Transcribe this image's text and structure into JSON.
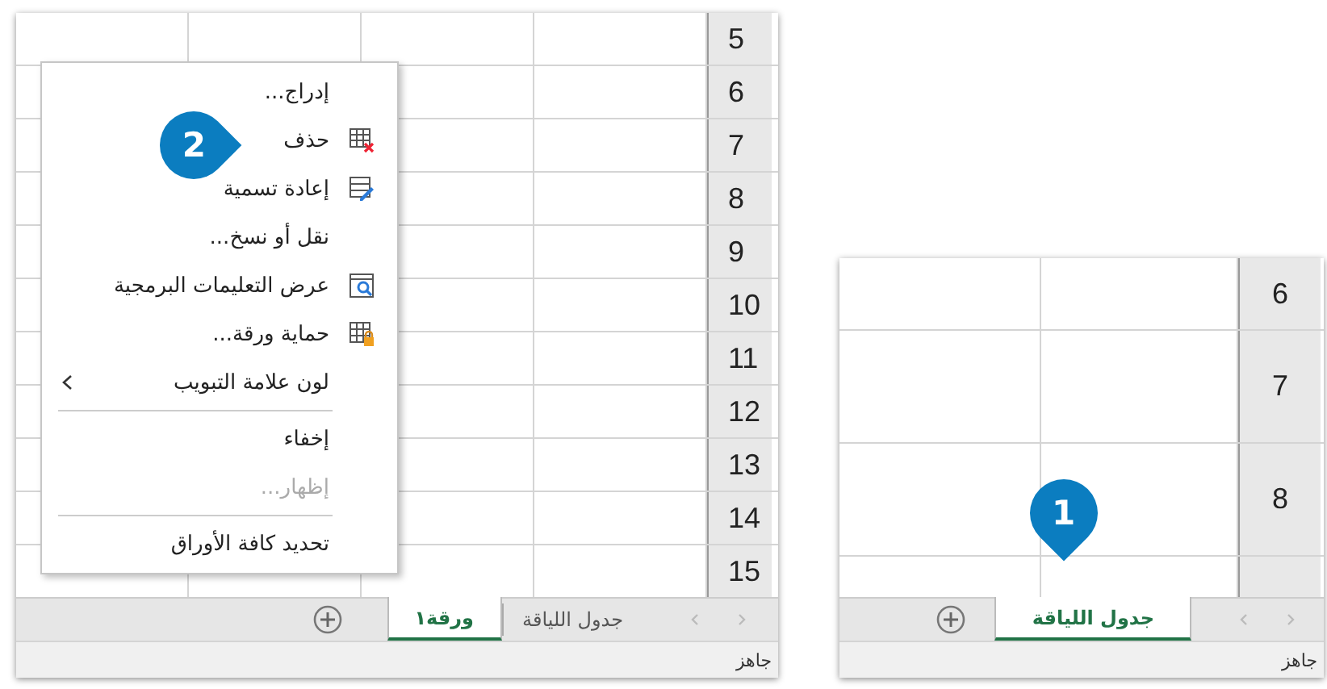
{
  "panels": [
    {
      "kind": "zoomed",
      "rows": [
        "6",
        "7",
        "8"
      ],
      "tabs": [
        {
          "label": "جدول اللياقة",
          "selected": true
        }
      ],
      "status": "جاهز",
      "callout": {
        "number": "1"
      }
    },
    {
      "kind": "full",
      "rows": [
        "5",
        "6",
        "7",
        "8",
        "9",
        "10",
        "11",
        "12",
        "13",
        "14",
        "15"
      ],
      "menu": [
        {
          "kind": "plain",
          "label": "إدراج...",
          "disabled": false
        },
        {
          "kind": "delete",
          "label": "حذف",
          "disabled": false
        },
        {
          "kind": "rename",
          "label": "إعادة تسمية",
          "disabled": false
        },
        {
          "kind": "plain",
          "label": "نقل أو نسخ...",
          "disabled": false
        },
        {
          "kind": "code",
          "label": "عرض التعليمات البرمجية",
          "disabled": false
        },
        {
          "kind": "protect",
          "label": "حماية ورقة...",
          "disabled": false
        },
        {
          "kind": "submenu",
          "label": "لون علامة التبويب",
          "disabled": false
        },
        {
          "kind": "separator"
        },
        {
          "kind": "plain",
          "label": "إخفاء",
          "disabled": false
        },
        {
          "kind": "plain",
          "label": "إظهار...",
          "disabled": true
        },
        {
          "kind": "separator"
        },
        {
          "kind": "plain",
          "label": "تحديد كافة الأوراق",
          "disabled": false
        }
      ],
      "tabs": [
        {
          "label": "جدول اللياقة",
          "selected": false
        },
        {
          "label": "ورقة١",
          "selected": true
        }
      ],
      "status": "جاهز",
      "callout": {
        "number": "2"
      }
    }
  ]
}
